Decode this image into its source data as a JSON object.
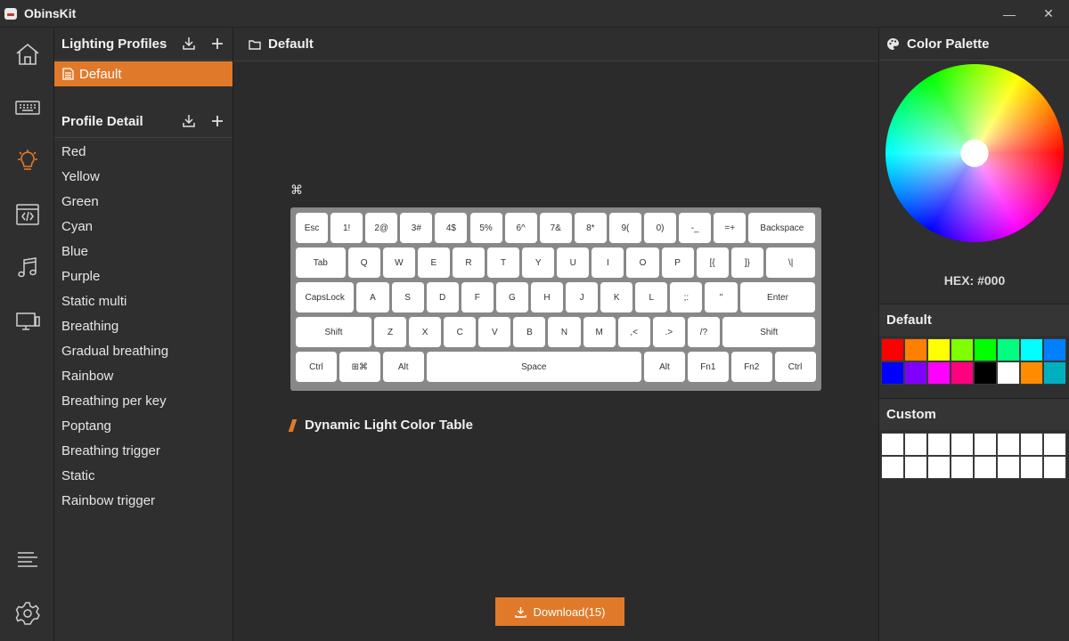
{
  "titlebar": {
    "title": "ObinsKit",
    "minimize": "—",
    "close": "✕"
  },
  "rail": {
    "items": [
      {
        "name": "home",
        "icon": "home-icon",
        "active": false
      },
      {
        "name": "keyboard",
        "icon": "keyboard-icon",
        "active": false
      },
      {
        "name": "lighting",
        "icon": "lightbulb-icon",
        "active": true
      },
      {
        "name": "macro",
        "icon": "code-window-icon",
        "active": false
      },
      {
        "name": "music",
        "icon": "music-note-icon",
        "active": false
      },
      {
        "name": "display",
        "icon": "monitor-icon",
        "active": false
      },
      {
        "name": "log",
        "icon": "list-lines-icon",
        "active": false
      },
      {
        "name": "settings",
        "icon": "gear-icon",
        "active": false
      }
    ],
    "accent": "#e07a2a"
  },
  "profiles": {
    "lighting_title": "Lighting Profiles",
    "selected": "Default",
    "detail_title": "Profile Detail",
    "details": [
      "Red",
      "Yellow",
      "Green",
      "Cyan",
      "Blue",
      "Purple",
      "Static multi",
      "Breathing",
      "Gradual breathing",
      "Rainbow",
      "Breathing per key",
      "Poptang",
      "Breathing trigger",
      "Static",
      "Rainbow trigger"
    ]
  },
  "main": {
    "title": "Default",
    "cmd_icon": "⌘",
    "keyboard_rows": [
      [
        "Esc",
        "1!",
        "2@",
        "3#",
        "4$",
        "5%",
        "6^",
        "7&",
        "8*",
        "9(",
        "0)",
        "-_",
        "=+",
        "Backspace"
      ],
      [
        "Tab",
        "Q",
        "W",
        "E",
        "R",
        "T",
        "Y",
        "U",
        "I",
        "O",
        "P",
        "[{",
        "]}",
        "\\|"
      ],
      [
        "CapsLock",
        "A",
        "S",
        "D",
        "F",
        "G",
        "H",
        "J",
        "K",
        "L",
        ";:",
        "\"",
        "Enter"
      ],
      [
        "Shift",
        "Z",
        "X",
        "C",
        "V",
        "B",
        "N",
        "M",
        ",<",
        ".>",
        "/?",
        "Shift"
      ],
      [
        "Ctrl",
        "⊞⌘",
        "Alt",
        "Space",
        "Alt",
        "Fn1",
        "Fn2",
        "Ctrl"
      ]
    ],
    "dynamic_title": "Dynamic Light Color Table",
    "download_label": "Download(15)"
  },
  "palette": {
    "title": "Color Palette",
    "hex": "HEX: #000",
    "default_title": "Default",
    "default_colors": [
      "#ff0000",
      "#ff7f00",
      "#ffff00",
      "#7fff00",
      "#00ff00",
      "#00ff7f",
      "#00ffff",
      "#007fff",
      "#0000ff",
      "#7f00ff",
      "#ff00ff",
      "#ff007f",
      "#000000",
      "#ffffff",
      "#ff8c00",
      "#00b0c0"
    ],
    "custom_title": "Custom",
    "custom_colors": [
      "#ffffff",
      "#ffffff",
      "#ffffff",
      "#ffffff",
      "#ffffff",
      "#ffffff",
      "#ffffff",
      "#ffffff",
      "#ffffff",
      "#ffffff",
      "#ffffff",
      "#ffffff",
      "#ffffff",
      "#ffffff",
      "#ffffff",
      "#ffffff"
    ]
  }
}
